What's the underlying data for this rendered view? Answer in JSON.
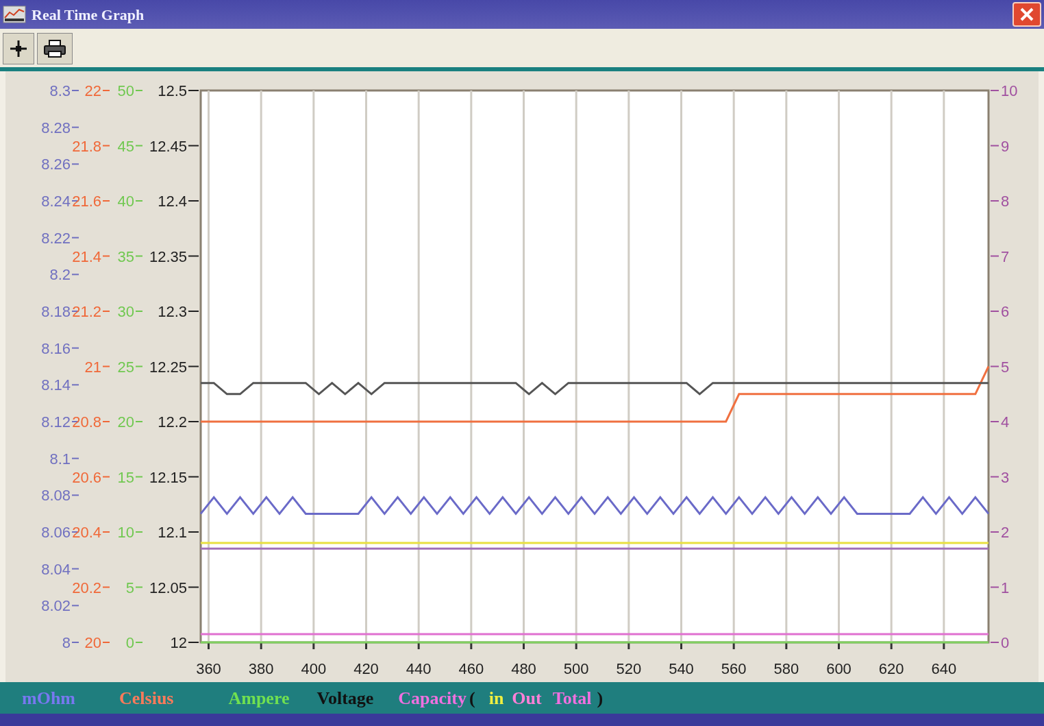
{
  "window": {
    "title": "Real Time Graph"
  },
  "toolbar": {
    "buttons": [
      {
        "kind": "crosshair"
      },
      {
        "kind": "printer"
      }
    ]
  },
  "left_scales": [
    {
      "color": "#7070c0",
      "labels": [
        "8.3",
        "8.28",
        "8.26",
        "8.24",
        "8.22",
        "8.2",
        "8.18",
        "8.16",
        "8.14",
        "8.12",
        "8.1",
        "8.08",
        "8.06",
        "8.04",
        "8.02",
        "8"
      ]
    },
    {
      "color": "#f06838",
      "labels": [
        "22",
        "21.8",
        "21.6",
        "21.4",
        "21.2",
        "21",
        "20.8",
        "20.6",
        "20.4",
        "20.2",
        "20"
      ]
    },
    {
      "color": "#70c850",
      "labels": [
        "50",
        "45",
        "40",
        "35",
        "30",
        "25",
        "20",
        "15",
        "10",
        "5",
        "0"
      ]
    },
    {
      "color": "#222222",
      "labels": [
        "12.5",
        "12.45",
        "12.4",
        "12.35",
        "12.3",
        "12.25",
        "12.2",
        "12.15",
        "12.1",
        "12.05",
        "12"
      ]
    }
  ],
  "chart_data": {
    "type": "line",
    "grid": true,
    "xlim": [
      357,
      657
    ],
    "ylim": [
      0,
      10
    ],
    "xticks": [
      360,
      380,
      400,
      420,
      440,
      460,
      480,
      500,
      520,
      540,
      560,
      580,
      600,
      620,
      640
    ],
    "yticks": [
      10,
      9,
      8,
      7,
      6,
      5,
      4,
      3,
      2,
      1,
      0
    ],
    "x": [
      357,
      362,
      367,
      372,
      377,
      382,
      387,
      392,
      397,
      402,
      407,
      412,
      417,
      422,
      427,
      432,
      437,
      442,
      447,
      452,
      457,
      462,
      467,
      472,
      477,
      482,
      487,
      492,
      497,
      502,
      507,
      512,
      517,
      522,
      527,
      532,
      537,
      542,
      547,
      552,
      557,
      562,
      567,
      572,
      577,
      582,
      587,
      592,
      597,
      602,
      607,
      612,
      617,
      622,
      627,
      632,
      637,
      642,
      647,
      652,
      657
    ],
    "series": [
      {
        "color": "#6a6ac8",
        "values": [
          2.33,
          2.63,
          2.33,
          2.63,
          2.33,
          2.63,
          2.33,
          2.63,
          2.33,
          2.33,
          2.33,
          2.33,
          2.33,
          2.63,
          2.33,
          2.63,
          2.33,
          2.63,
          2.33,
          2.63,
          2.33,
          2.63,
          2.33,
          2.63,
          2.33,
          2.63,
          2.33,
          2.63,
          2.33,
          2.63,
          2.33,
          2.63,
          2.33,
          2.63,
          2.33,
          2.63,
          2.33,
          2.63,
          2.33,
          2.63,
          2.33,
          2.63,
          2.33,
          2.63,
          2.33,
          2.63,
          2.33,
          2.63,
          2.33,
          2.63,
          2.33,
          2.33,
          2.33,
          2.33,
          2.33,
          2.63,
          2.33,
          2.63,
          2.33,
          2.63,
          2.33
        ]
      },
      {
        "color": "#f07040",
        "values": [
          4,
          4,
          4,
          4,
          4,
          4,
          4,
          4,
          4,
          4,
          4,
          4,
          4,
          4,
          4,
          4,
          4,
          4,
          4,
          4,
          4,
          4,
          4,
          4,
          4,
          4,
          4,
          4,
          4,
          4,
          4,
          4,
          4,
          4,
          4,
          4,
          4,
          4,
          4,
          4,
          4,
          4.5,
          4.5,
          4.5,
          4.5,
          4.5,
          4.5,
          4.5,
          4.5,
          4.5,
          4.5,
          4.5,
          4.5,
          4.5,
          4.5,
          4.5,
          4.5,
          4.5,
          4.5,
          4.5,
          5
        ]
      },
      {
        "color": "#80d060",
        "values": [
          0,
          0,
          0,
          0,
          0,
          0,
          0,
          0,
          0,
          0,
          0,
          0,
          0,
          0,
          0,
          0,
          0,
          0,
          0,
          0,
          0,
          0,
          0,
          0,
          0,
          0,
          0,
          0,
          0,
          0,
          0,
          0,
          0,
          0,
          0,
          0,
          0,
          0,
          0,
          0,
          0,
          0,
          0,
          0,
          0,
          0,
          0,
          0,
          0,
          0,
          0,
          0,
          0,
          0,
          0,
          0,
          0,
          0,
          0,
          0,
          0
        ]
      },
      {
        "color": "#555555",
        "values": [
          4.7,
          4.7,
          4.5,
          4.5,
          4.7,
          4.7,
          4.7,
          4.7,
          4.7,
          4.5,
          4.7,
          4.5,
          4.7,
          4.5,
          4.7,
          4.7,
          4.7,
          4.7,
          4.7,
          4.7,
          4.7,
          4.7,
          4.7,
          4.7,
          4.7,
          4.5,
          4.7,
          4.5,
          4.7,
          4.7,
          4.7,
          4.7,
          4.7,
          4.7,
          4.7,
          4.7,
          4.7,
          4.7,
          4.5,
          4.7,
          4.7,
          4.7,
          4.7,
          4.7,
          4.7,
          4.7,
          4.7,
          4.7,
          4.7,
          4.7,
          4.7,
          4.7,
          4.7,
          4.7,
          4.7,
          4.7,
          4.7,
          4.7,
          4.7,
          4.7,
          4.7
        ]
      },
      {
        "color": "#e8e040",
        "values": [
          1.8,
          1.8,
          1.8,
          1.8,
          1.8,
          1.8,
          1.8,
          1.8,
          1.8,
          1.8,
          1.8,
          1.8,
          1.8,
          1.8,
          1.8,
          1.8,
          1.8,
          1.8,
          1.8,
          1.8,
          1.8,
          1.8,
          1.8,
          1.8,
          1.8,
          1.8,
          1.8,
          1.8,
          1.8,
          1.8,
          1.8,
          1.8,
          1.8,
          1.8,
          1.8,
          1.8,
          1.8,
          1.8,
          1.8,
          1.8,
          1.8,
          1.8,
          1.8,
          1.8,
          1.8,
          1.8,
          1.8,
          1.8,
          1.8,
          1.8,
          1.8,
          1.8,
          1.8,
          1.8,
          1.8,
          1.8,
          1.8,
          1.8,
          1.8,
          1.8,
          1.8
        ]
      },
      {
        "color": "#e070d0",
        "values": [
          0.15,
          0.15,
          0.15,
          0.15,
          0.15,
          0.15,
          0.15,
          0.15,
          0.15,
          0.15,
          0.15,
          0.15,
          0.15,
          0.15,
          0.15,
          0.15,
          0.15,
          0.15,
          0.15,
          0.15,
          0.15,
          0.15,
          0.15,
          0.15,
          0.15,
          0.15,
          0.15,
          0.15,
          0.15,
          0.15,
          0.15,
          0.15,
          0.15,
          0.15,
          0.15,
          0.15,
          0.15,
          0.15,
          0.15,
          0.15,
          0.15,
          0.15,
          0.15,
          0.15,
          0.15,
          0.15,
          0.15,
          0.15,
          0.15,
          0.15,
          0.15,
          0.15,
          0.15,
          0.15,
          0.15,
          0.15,
          0.15,
          0.15,
          0.15,
          0.15,
          0.15
        ]
      },
      {
        "color": "#a070b8",
        "values": [
          1.7,
          1.7,
          1.7,
          1.7,
          1.7,
          1.7,
          1.7,
          1.7,
          1.7,
          1.7,
          1.7,
          1.7,
          1.7,
          1.7,
          1.7,
          1.7,
          1.7,
          1.7,
          1.7,
          1.7,
          1.7,
          1.7,
          1.7,
          1.7,
          1.7,
          1.7,
          1.7,
          1.7,
          1.7,
          1.7,
          1.7,
          1.7,
          1.7,
          1.7,
          1.7,
          1.7,
          1.7,
          1.7,
          1.7,
          1.7,
          1.7,
          1.7,
          1.7,
          1.7,
          1.7,
          1.7,
          1.7,
          1.7,
          1.7,
          1.7,
          1.7,
          1.7,
          1.7,
          1.7,
          1.7,
          1.7,
          1.7,
          1.7,
          1.7,
          1.7,
          1.7
        ]
      }
    ]
  },
  "legend": [
    {
      "text": "mOhm",
      "color": "#7878f0"
    },
    {
      "text": "Celsius",
      "color": "#ff7a5a"
    },
    {
      "text": "Ampere",
      "color": "#70e050"
    },
    {
      "text": "Voltage",
      "color": "#111111"
    },
    {
      "text": "Capacity",
      "color": "#f070e0"
    },
    {
      "text": "(",
      "color": "#111111"
    },
    {
      "text": "in",
      "color": "#f0f040"
    },
    {
      "text": "Out",
      "color": "#ff80d8"
    },
    {
      "text": "Total",
      "color": "#f070e0"
    },
    {
      "text": ")",
      "color": "#111111"
    }
  ]
}
